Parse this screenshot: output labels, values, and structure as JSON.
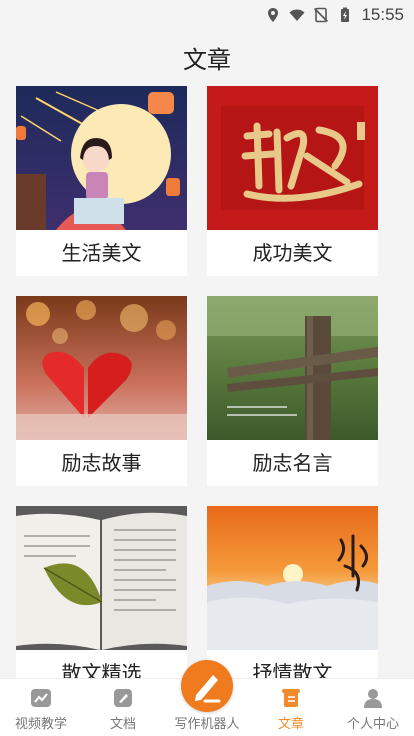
{
  "status_bar": {
    "time": "15:55"
  },
  "header": {
    "title": "文章"
  },
  "categories": [
    {
      "label": "生活美文",
      "image": "girl-moon-illustration"
    },
    {
      "label": "成功美文",
      "image": "calligraphy-red-banner"
    },
    {
      "label": "励志故事",
      "image": "red-hearts-bokeh"
    },
    {
      "label": "励志名言",
      "image": "wooden-fence-post"
    },
    {
      "label": "散文精选",
      "image": "open-book-leaf"
    },
    {
      "label": "抒情散文",
      "image": "sunset-over-clouds"
    }
  ],
  "nav": {
    "items": [
      {
        "label": "视频教学",
        "icon": "trend-chart-icon"
      },
      {
        "label": "文档",
        "icon": "document-edit-icon"
      },
      {
        "label": "写作机器人",
        "icon": "pen-icon"
      },
      {
        "label": "文章",
        "icon": "article-scroll-icon",
        "active": true
      },
      {
        "label": "个人中心",
        "icon": "person-icon"
      }
    ]
  },
  "colors": {
    "accent": "#f08a2c",
    "fab": "#f07a1e",
    "background": "#f4f4f4"
  }
}
